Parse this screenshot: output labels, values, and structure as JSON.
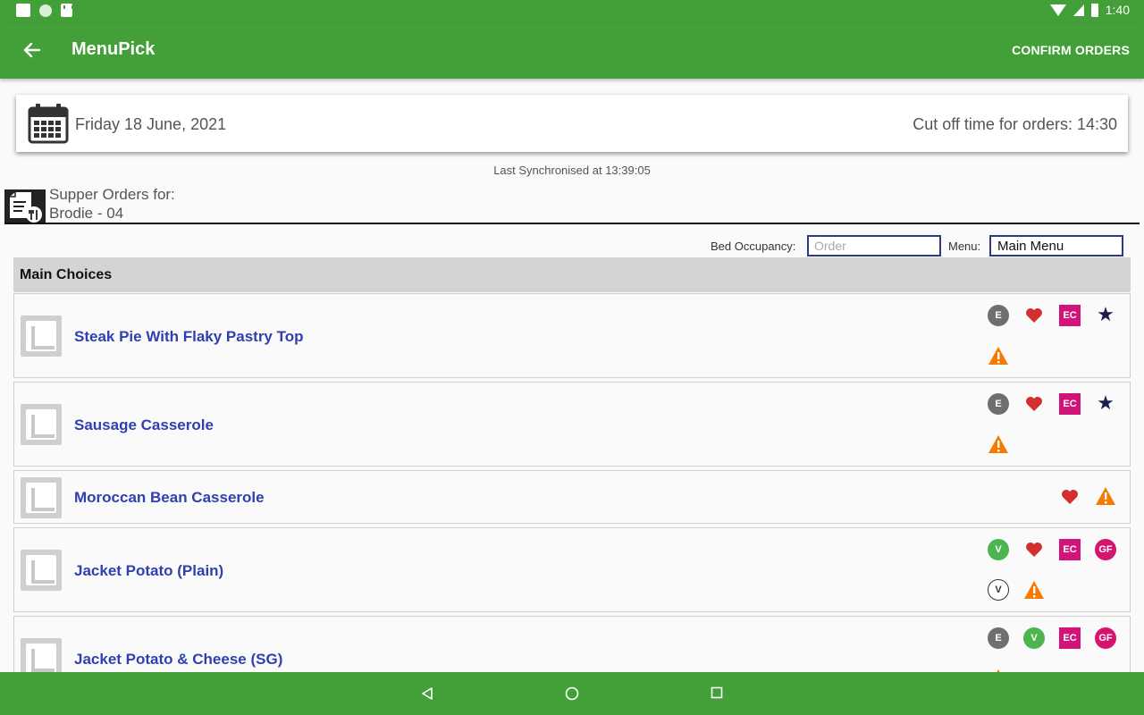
{
  "status_bar": {
    "time": "1:40"
  },
  "app_bar": {
    "title": "MenuPick",
    "confirm_label": "CONFIRM ORDERS"
  },
  "date_card": {
    "date": "Friday 18 June, 2021",
    "cutoff": "Cut off time for orders: 14:30"
  },
  "sync": {
    "text": "Last Synchronised at 13:39:05"
  },
  "orders": {
    "label": "Supper Orders for:",
    "room": "Brodie - 04"
  },
  "filters": {
    "bed_label": "Bed Occupancy:",
    "bed_placeholder": "Order",
    "menu_label": "Menu:",
    "menu_value": "Main Menu"
  },
  "section": {
    "title": "Main Choices"
  },
  "items": [
    {
      "name": "Steak Pie With Flaky Pastry Top",
      "icons": [
        "E",
        "heart-icon",
        "EC",
        "star-icon",
        "warning-icon"
      ]
    },
    {
      "name": "Sausage Casserole",
      "icons": [
        "E",
        "heart-icon",
        "EC",
        "star-icon",
        "warning-icon"
      ]
    },
    {
      "name": "Moroccan Bean Casserole",
      "icons": [
        "heart-icon",
        "warning-icon"
      ]
    },
    {
      "name": "Jacket Potato (Plain)",
      "icons": [
        "V",
        "heart-icon",
        "EC",
        "GF",
        "V",
        "warning-icon"
      ]
    },
    {
      "name": "Jacket Potato & Cheese (SG)",
      "icons": [
        "E",
        "V",
        "EC",
        "GF",
        "warning-icon"
      ]
    }
  ],
  "colors": {
    "brand_green": "#43a038",
    "link_blue": "#3140b0",
    "ec_magenta": "#d1137a",
    "gf_pink": "#d6136f",
    "veg_green": "#4cb550",
    "warning_orange": "#f57c00",
    "heart_red": "#d32f2f"
  }
}
